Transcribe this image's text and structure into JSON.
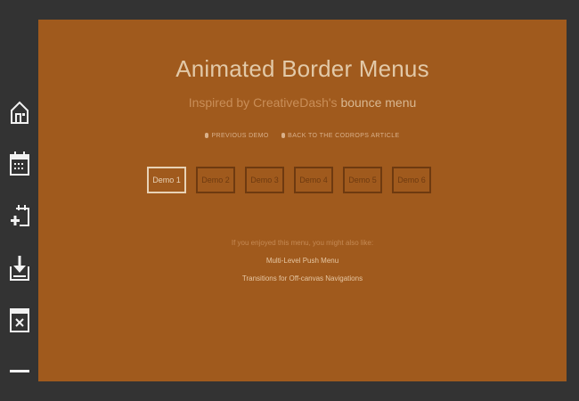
{
  "page": {
    "title": "Animated Border Menus",
    "subtitle_prefix": "Inspired by CreativeDash's",
    "subtitle_link": "bounce menu"
  },
  "nav_links": {
    "previous": "PREVIOUS DEMO",
    "back": "BACK TO THE CODROPS ARTICLE"
  },
  "demos": [
    "Demo 1",
    "Demo 2",
    "Demo 3",
    "Demo 4",
    "Demo 5",
    "Demo 6"
  ],
  "related": {
    "intro": "If you enjoyed this menu, you might also like:",
    "links": [
      "Multi-Level Push Menu",
      "Transitions for Off-canvas Navigations"
    ]
  },
  "sidebar": {
    "icons": [
      "home-icon",
      "calendar-icon",
      "add-calendar-icon",
      "download-icon",
      "close-window-icon",
      "minus-icon"
    ]
  },
  "colors": {
    "background": "#a05a1d",
    "frame": "#333333",
    "active_border": "#e8d2b6",
    "inactive_border": "#6e3a10"
  }
}
